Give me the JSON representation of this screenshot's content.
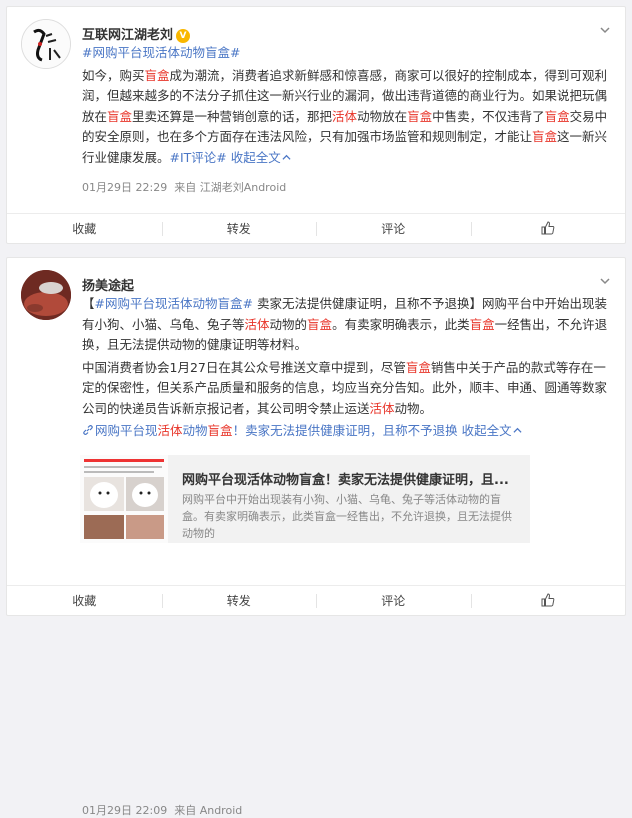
{
  "post1": {
    "author": "互联网江湖老刘",
    "verified_mark": "V",
    "topic_line": "#网购平台现活体动物盲盒#",
    "text": {
      "a": "如今，购买",
      "b": "盲盒",
      "c": "成为潮流，消费者追求新鲜感和惊喜感，商家可以很好的控制成本，得到可观利润，但越来越多的不法分子抓住这一新兴行业的漏洞，做出违背道德的商业行为。如果说把玩偶放在",
      "d": "盲盒",
      "e": "里卖还算是一种营销创意的话，那把",
      "f": "活体",
      "g": "动物放在",
      "h": "盲盒",
      "i": "中售卖，不仅违背了",
      "j": "盲盒",
      "k": "交易中的安全原则，也在多个方面存在违法风险，只有加强市场监管和规则制定，才能让",
      "l": "盲盒",
      "m": "这一新兴行业健康发展。",
      "tag": "#IT评论#",
      "collapse": "收起全文"
    },
    "time": "01月29日 22:29",
    "source": "来自 江湖老刘Android"
  },
  "post2": {
    "author": "扬美途起",
    "text": {
      "a": "【",
      "topic": "#网购平台现活体动物盲盒#",
      "b": " 卖家无法提供健康证明，且称不予退换】",
      "c": "网购平台中开始出现装有小狗、小猫、乌龟、兔子等",
      "d": "活体",
      "e": "动物的",
      "f": "盲盒",
      "g": "。有卖家明确表示，此类",
      "h": "盲盒",
      "i": "一经售出，不允许退换，且无法提供动物的健康证明等材料。",
      "p2a": "中国消费者协会1月27日在其公众号推送文章中提到，尽管",
      "p2b": "盲盒",
      "p2c": "销售中关于产品的款式等存在一定的保密性，但关系产品质量和服务的信息，均应当充分告知。此外，顺丰、申通、圆通等数家公司的快递员告诉新京报记者，其公司明令禁止运送",
      "p2d": "活体",
      "p2e": "动物。",
      "link_a": "网购平台现",
      "link_b": "活体",
      "link_c": "动物",
      "link_d": "盲盒",
      "link_e": "！卖家无法提供健康证明，且称不予退换",
      "collapse": "收起全文"
    },
    "card": {
      "title": "网购平台现活体动物盲盒！卖家无法提供健康证明，且...",
      "desc": "网购平台中开始出现装有小狗、小猫、乌龟、兔子等活体动物的盲盒。有卖家明确表示，此类盲盒一经售出，不允许退换，且无法提供动物的"
    },
    "time": "01月29日 22:09",
    "source": "来自 Android"
  },
  "toolbar": {
    "collect": "收藏",
    "repost": "转发",
    "comment": "评论"
  },
  "colors": {
    "link": "#4a76c5",
    "highlight": "#e8352a",
    "meta": "#888888"
  }
}
